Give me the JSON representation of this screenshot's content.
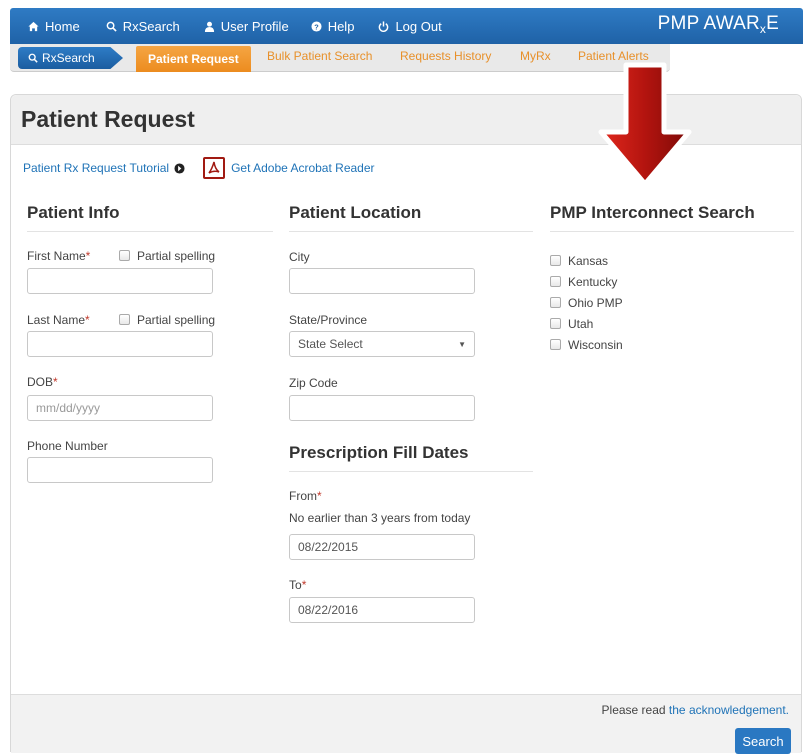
{
  "topnav": {
    "items": [
      {
        "label": "Home",
        "icon": "home-icon"
      },
      {
        "label": "RxSearch",
        "icon": "search-icon"
      },
      {
        "label": "User Profile",
        "icon": "user-icon"
      },
      {
        "label": "Help",
        "icon": "help-icon"
      },
      {
        "label": "Log Out",
        "icon": "power-icon"
      }
    ],
    "brand_main": "PMP AWAR",
    "brand_sub": "x",
    "brand_end": "E"
  },
  "subnav": {
    "pill": "RxSearch",
    "tabs": [
      {
        "label": "Patient Request",
        "active": true
      },
      {
        "label": "Bulk Patient Search",
        "active": false
      },
      {
        "label": "Requests History",
        "active": false
      },
      {
        "label": "MyRx",
        "active": false
      },
      {
        "label": "Patient Alerts",
        "active": false
      }
    ]
  },
  "page": {
    "title": "Patient Request",
    "tutorial_link": "Patient Rx Request Tutorial",
    "acrobat_link": "Get Adobe Acrobat Reader"
  },
  "patient_info": {
    "title": "Patient Info",
    "first_name_label": "First Name",
    "last_name_label": "Last Name",
    "partial_label": "Partial spelling",
    "dob_label": "DOB",
    "dob_placeholder": "mm/dd/yyyy",
    "phone_label": "Phone Number",
    "required_mark": "*"
  },
  "patient_location": {
    "title": "Patient Location",
    "city_label": "City",
    "state_label": "State/Province",
    "state_selected": "State Select",
    "zip_label": "Zip Code"
  },
  "fill_dates": {
    "title": "Prescription Fill Dates",
    "from_label": "From",
    "from_hint": "No earlier than 3 years from today",
    "from_value": "08/22/2015",
    "to_label": "To",
    "to_value": "08/22/2016"
  },
  "interconnect": {
    "title": "PMP Interconnect Search",
    "states": [
      "Kansas",
      "Kentucky",
      "Ohio PMP",
      "Utah",
      "Wisconsin"
    ]
  },
  "footer": {
    "ack_prefix": "Please read",
    "ack_link": "the acknowledgement.",
    "search_button": "Search"
  },
  "colors": {
    "nav_blue": "#2a72bb",
    "active_tab_orange": "#f0952b",
    "arrow_red": "#b3140f"
  }
}
